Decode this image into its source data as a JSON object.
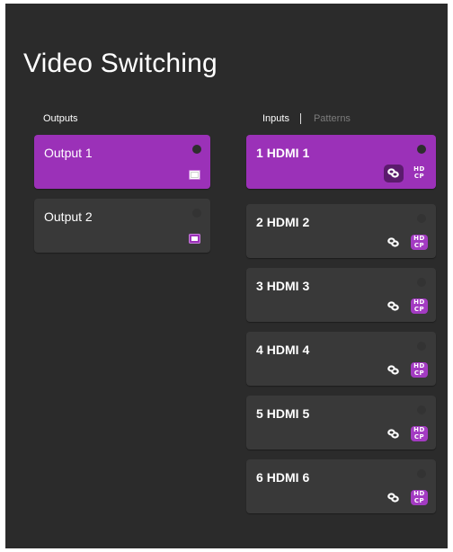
{
  "page": {
    "title": "Video Switching"
  },
  "outputs": {
    "header": "Outputs",
    "items": [
      {
        "label": "Output 1",
        "selected": true,
        "icon": "display-icon"
      },
      {
        "label": "Output 2",
        "selected": false,
        "icon": "display-icon"
      }
    ]
  },
  "inputs": {
    "tabs": [
      {
        "label": "Inputs",
        "active": true
      },
      {
        "label": "Patterns",
        "active": false
      }
    ],
    "items": [
      {
        "num": "1",
        "label": "HDMI 1",
        "selected": true,
        "hdcp_line1": "HD",
        "hdcp_line2": "CP"
      },
      {
        "num": "2",
        "label": "HDMI 2",
        "selected": false,
        "hdcp_line1": "HD",
        "hdcp_line2": "CP"
      },
      {
        "num": "3",
        "label": "HDMI 3",
        "selected": false,
        "hdcp_line1": "HD",
        "hdcp_line2": "CP"
      },
      {
        "num": "4",
        "label": "HDMI 4",
        "selected": false,
        "hdcp_line1": "HD",
        "hdcp_line2": "CP"
      },
      {
        "num": "5",
        "label": "HDMI 5",
        "selected": false,
        "hdcp_line1": "HD",
        "hdcp_line2": "CP"
      },
      {
        "num": "6",
        "label": "HDMI 6",
        "selected": false,
        "hdcp_line1": "HD",
        "hdcp_line2": "CP"
      }
    ]
  },
  "colors": {
    "background": "#2b2b2b",
    "card": "#393939",
    "accent": "#9b31b8"
  }
}
